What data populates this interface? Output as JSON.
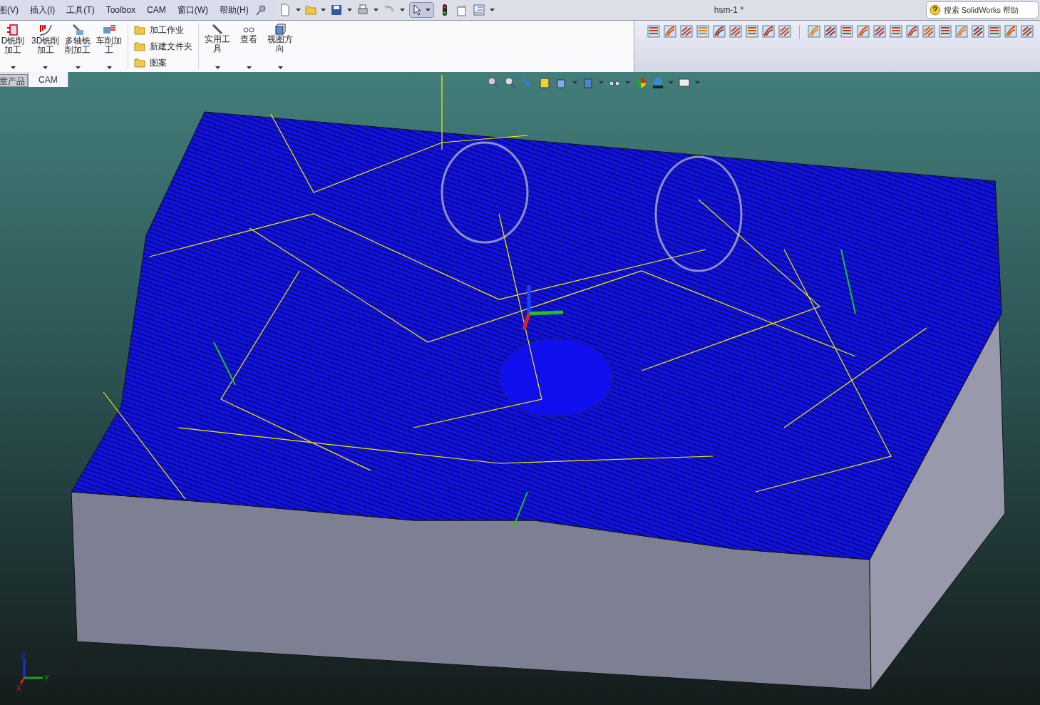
{
  "menu": [
    "图(V)",
    "插入(I)",
    "工具(T)",
    "Toolbox",
    "CAM",
    "窗口(W)",
    "帮助(H)"
  ],
  "window": {
    "title": "hsm-1 *"
  },
  "help_search": {
    "placeholder": "搜索 SolidWorks 帮助"
  },
  "command_manager": {
    "machining_buttons": [
      {
        "label_lines": [
          "D铣削",
          "加工"
        ]
      },
      {
        "label_lines": [
          "3D铣削",
          "加工"
        ]
      },
      {
        "label_lines": [
          "多轴铣",
          "削加工"
        ]
      },
      {
        "label_lines": [
          "车削加",
          "工"
        ]
      }
    ],
    "list_buttons": [
      "加工作业",
      "新建文件夹",
      "图案"
    ],
    "tool_buttons": [
      {
        "label_lines": [
          "实用工",
          "具"
        ]
      },
      {
        "label_lines": [
          "查看"
        ]
      },
      {
        "label_lines": [
          "视图方",
          "向"
        ]
      }
    ]
  },
  "tabs": [
    {
      "label": "室产品",
      "selected": false
    },
    {
      "label": "CAM",
      "selected": true
    }
  ],
  "triad": {
    "z": "Z",
    "y": "Y",
    "x": "X"
  }
}
